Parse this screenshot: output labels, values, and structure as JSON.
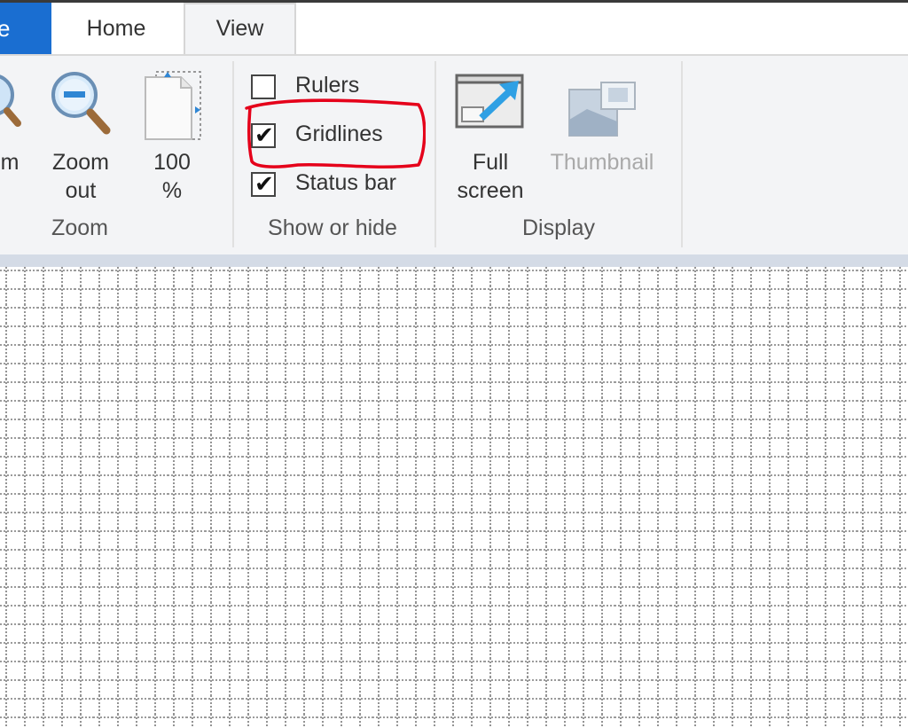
{
  "tabs": {
    "file": "e",
    "home": "Home",
    "view": "View"
  },
  "zoom_group": {
    "zoom_in_label_partial": "m",
    "zoom_out_label_line1": "Zoom",
    "zoom_out_label_line2": "out",
    "hundred_label_line1": "100",
    "hundred_label_line2": "%",
    "group_label": "Zoom"
  },
  "show_hide_group": {
    "rulers_label": "Rulers",
    "rulers_checked": false,
    "gridlines_label": "Gridlines",
    "gridlines_checked": true,
    "statusbar_label": "Status bar",
    "statusbar_checked": true,
    "group_label": "Show or hide"
  },
  "display_group": {
    "fullscreen_label_line1": "Full",
    "fullscreen_label_line2": "screen",
    "thumbnail_label": "Thumbnail",
    "group_label": "Display"
  },
  "icons": {
    "zoom_in": "zoom-in-icon",
    "zoom_out": "zoom-out-icon",
    "hundred_percent": "page-100-percent-icon",
    "full_screen": "full-screen-icon",
    "thumbnail": "thumbnail-icon",
    "check": "checkmark-icon"
  },
  "colors": {
    "file_tab": "#1a6ed1",
    "annotation": "#e5001a",
    "ribbon_bg": "#f3f4f6",
    "canvas_frame": "#d4dbe6"
  }
}
